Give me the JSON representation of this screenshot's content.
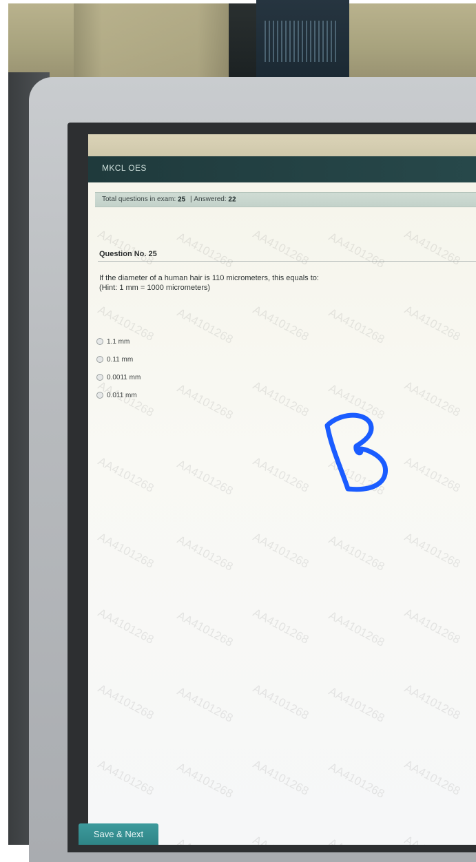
{
  "app": {
    "title": "MKCL OES"
  },
  "exam_status": {
    "total_label": "Total questions in exam:",
    "total": "25",
    "separator": "|",
    "answered_label": "Answered:",
    "answered": "22"
  },
  "question": {
    "heading": "Question No. 25",
    "text": "If the diameter of a human hair is 110 micrometers, this equals to:",
    "hint": "(Hint: 1 mm = 1000 micrometers)",
    "options": [
      "1.1 mm",
      "0.11 mm",
      "0.0011 mm",
      "0.011 mm"
    ]
  },
  "watermark": "AA4101268",
  "handwritten_annotation": "B",
  "actions": {
    "save_next": "Save & Next"
  },
  "colors": {
    "header_bg": "#1f3a3c",
    "status_bar_bg": "#cfdcd4",
    "button_bg": "#3d9a9c",
    "annotation_ink": "#1a5cff"
  }
}
